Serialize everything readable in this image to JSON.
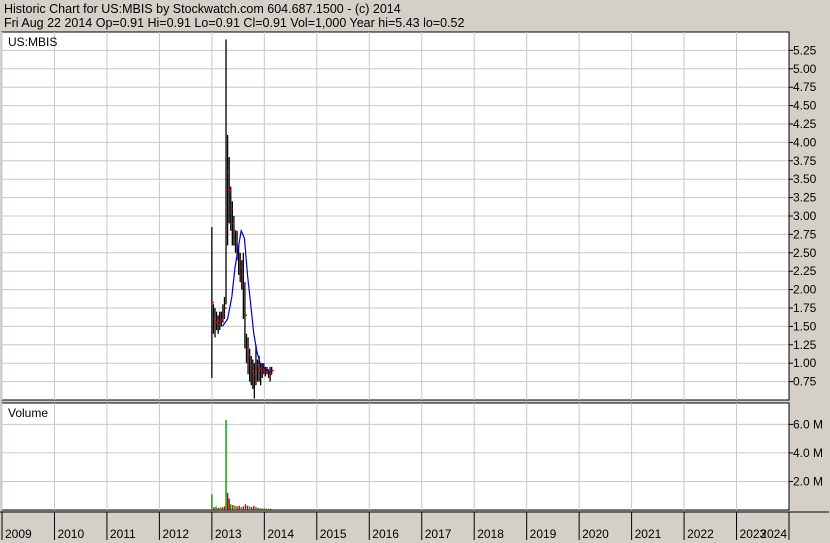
{
  "header": {
    "line1": "Historic Chart for US:MBIS by Stockwatch.com 604.687.1500 - (c) 2014",
    "line2": "Fri Aug 22 2014   Op=0.91   Hi=0.91   Lo=0.91   Cl=0.91   Vol=1,000   Year hi=5.43   lo=0.52"
  },
  "chart_data": [
    {
      "type": "line",
      "panel": "price",
      "title": "US:MBIS",
      "y_ticks": [
        "0.75",
        "1.00",
        "1.25",
        "1.50",
        "1.75",
        "2.00",
        "2.25",
        "2.50",
        "2.75",
        "3.00",
        "3.25",
        "3.50",
        "3.75",
        "4.00",
        "4.25",
        "4.50",
        "4.75",
        "5.00",
        "5.25"
      ],
      "ylim": [
        0.5,
        5.5
      ],
      "x_ticks": [
        "2009",
        "2010",
        "2011",
        "2012",
        "2013",
        "2014",
        "2015",
        "2016",
        "2017",
        "2018",
        "2019",
        "2020",
        "2021",
        "2022",
        "2023",
        "2024"
      ],
      "xlim": [
        2009.0,
        2024.0
      ],
      "grid": true,
      "colors": {
        "price": "#000000",
        "moving_average": "#0000cc",
        "close_marks": "#cc0000"
      },
      "series": [
        {
          "style": "high-low bars",
          "points": [
            [
              2013.0,
              0.8,
              2.85
            ],
            [
              2013.03,
              1.4,
              1.8
            ],
            [
              2013.06,
              1.35,
              1.75
            ],
            [
              2013.09,
              1.45,
              1.7
            ],
            [
              2013.12,
              1.4,
              1.65
            ],
            [
              2013.15,
              1.45,
              1.7
            ],
            [
              2013.18,
              1.5,
              1.7
            ],
            [
              2013.21,
              1.55,
              1.8
            ],
            [
              2013.24,
              1.6,
              1.9
            ],
            [
              2013.27,
              1.8,
              5.4
            ],
            [
              2013.3,
              2.6,
              4.1
            ],
            [
              2013.33,
              2.9,
              3.8
            ],
            [
              2013.36,
              2.8,
              3.4
            ],
            [
              2013.39,
              2.6,
              3.2
            ],
            [
              2013.42,
              2.6,
              3.0
            ],
            [
              2013.45,
              2.5,
              2.8
            ],
            [
              2013.48,
              2.4,
              2.8
            ],
            [
              2013.51,
              2.2,
              2.6
            ],
            [
              2013.54,
              2.1,
              2.5
            ],
            [
              2013.57,
              2.0,
              2.4
            ],
            [
              2013.6,
              1.6,
              2.5
            ],
            [
              2013.63,
              1.2,
              2.1
            ],
            [
              2013.66,
              1.0,
              1.4
            ],
            [
              2013.69,
              0.85,
              1.35
            ],
            [
              2013.72,
              0.75,
              1.2
            ],
            [
              2013.75,
              0.7,
              1.1
            ],
            [
              2013.78,
              0.65,
              1.05
            ],
            [
              2013.81,
              0.52,
              1.0
            ],
            [
              2013.84,
              0.7,
              1.25
            ],
            [
              2013.87,
              0.75,
              1.05
            ],
            [
              2013.9,
              0.75,
              1.1
            ],
            [
              2013.93,
              0.7,
              1.0
            ],
            [
              2013.96,
              0.8,
              1.0
            ],
            [
              2013.99,
              0.85,
              1.0
            ],
            [
              2014.02,
              0.82,
              0.95
            ],
            [
              2014.05,
              0.85,
              0.95
            ],
            [
              2014.08,
              0.8,
              0.92
            ],
            [
              2014.11,
              0.75,
              0.95
            ],
            [
              2014.14,
              0.85,
              0.95
            ]
          ]
        },
        {
          "name": "",
          "style": "moving average",
          "values": [
            [
              2013.2,
              1.5
            ],
            [
              2013.3,
              1.6
            ],
            [
              2013.38,
              1.9
            ],
            [
              2013.44,
              2.3
            ],
            [
              2013.5,
              2.55
            ],
            [
              2013.56,
              2.8
            ],
            [
              2013.62,
              2.7
            ],
            [
              2013.68,
              2.2
            ],
            [
              2013.74,
              1.8
            ],
            [
              2013.8,
              1.4
            ],
            [
              2013.86,
              1.15
            ],
            [
              2013.92,
              1.0
            ],
            [
              2013.98,
              0.95
            ],
            [
              2014.05,
              0.9
            ],
            [
              2014.12,
              0.87
            ]
          ]
        }
      ]
    },
    {
      "type": "bar",
      "panel": "volume",
      "title": "Volume",
      "y_ticks": [
        "2.0 M",
        "4.0 M",
        "6.0 M"
      ],
      "ylim": [
        0,
        7.5
      ],
      "colors": {
        "up": "#009900",
        "down": "#cc0000"
      },
      "bars": [
        [
          2013.0,
          1.1,
          "up"
        ],
        [
          2013.04,
          0.2,
          "down"
        ],
        [
          2013.08,
          0.25,
          "up"
        ],
        [
          2013.12,
          0.15,
          "down"
        ],
        [
          2013.16,
          0.18,
          "up"
        ],
        [
          2013.2,
          0.2,
          "down"
        ],
        [
          2013.24,
          0.25,
          "down"
        ],
        [
          2013.27,
          6.3,
          "up"
        ],
        [
          2013.3,
          1.2,
          "down"
        ],
        [
          2013.33,
          0.8,
          "down"
        ],
        [
          2013.36,
          0.4,
          "up"
        ],
        [
          2013.4,
          0.35,
          "down"
        ],
        [
          2013.44,
          0.3,
          "up"
        ],
        [
          2013.48,
          0.25,
          "down"
        ],
        [
          2013.52,
          0.3,
          "down"
        ],
        [
          2013.56,
          0.2,
          "up"
        ],
        [
          2013.6,
          0.25,
          "down"
        ],
        [
          2013.64,
          0.4,
          "down"
        ],
        [
          2013.68,
          0.3,
          "down"
        ],
        [
          2013.72,
          0.25,
          "up"
        ],
        [
          2013.76,
          0.2,
          "down"
        ],
        [
          2013.8,
          0.3,
          "down"
        ],
        [
          2013.84,
          0.2,
          "up"
        ],
        [
          2013.88,
          0.15,
          "down"
        ],
        [
          2013.92,
          0.12,
          "up"
        ],
        [
          2013.96,
          0.1,
          "down"
        ],
        [
          2014.0,
          0.12,
          "up"
        ],
        [
          2014.04,
          0.08,
          "down"
        ],
        [
          2014.08,
          0.1,
          "up"
        ],
        [
          2014.12,
          0.08,
          "down"
        ]
      ]
    }
  ]
}
